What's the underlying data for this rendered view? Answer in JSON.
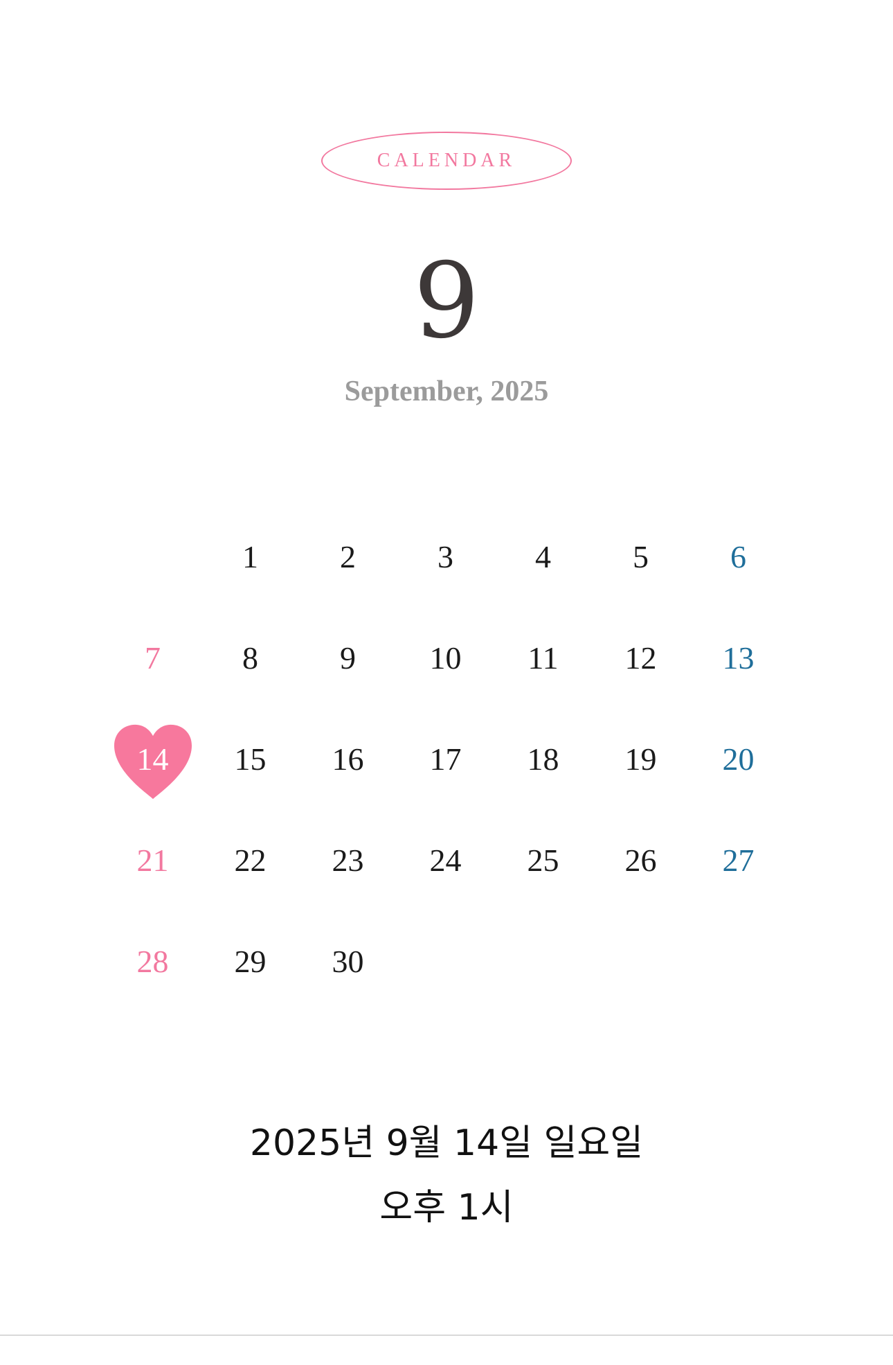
{
  "header": {
    "badge_label": "CALENDAR"
  },
  "month": {
    "number": "9",
    "label": "September, 2025"
  },
  "calendar": {
    "selected_day": "14",
    "weeks": [
      [
        "",
        "1",
        "2",
        "3",
        "4",
        "5",
        "6"
      ],
      [
        "7",
        "8",
        "9",
        "10",
        "11",
        "12",
        "13"
      ],
      [
        "14",
        "15",
        "16",
        "17",
        "18",
        "19",
        "20"
      ],
      [
        "21",
        "22",
        "23",
        "24",
        "25",
        "26",
        "27"
      ],
      [
        "28",
        "29",
        "30",
        "",
        "",
        "",
        ""
      ]
    ],
    "colors": {
      "sunday": "#f2789f",
      "saturday": "#1f6e9a",
      "weekday": "#1a1a1a",
      "heart": "#f7789d"
    }
  },
  "event": {
    "date": "2025년 9월 14일 일요일",
    "time": "오후 1시"
  }
}
